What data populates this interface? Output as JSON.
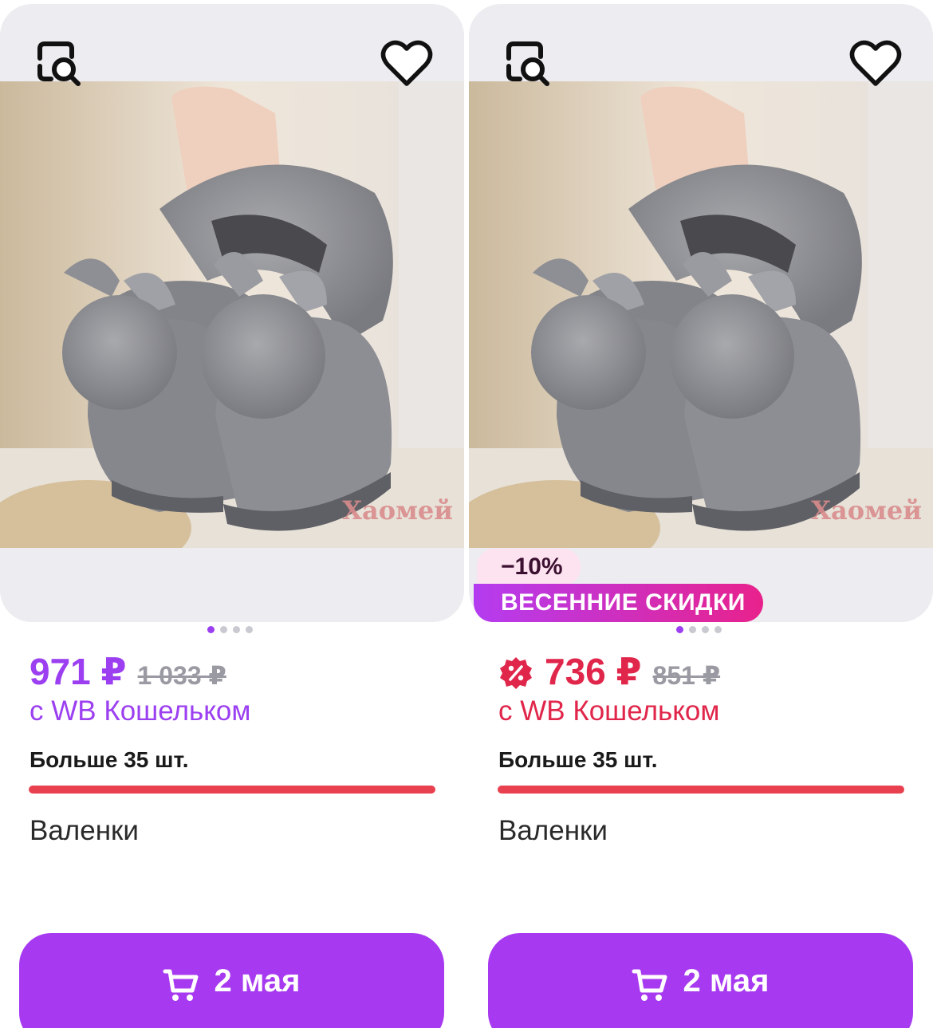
{
  "colors": {
    "accent_purple": "#9b3ff0",
    "price_red": "#e0264a",
    "stock_bar": "#e8404f",
    "button": "#a73af0"
  },
  "cards": [
    {
      "image_watermark": "Хаомей",
      "price": "971 ₽",
      "old_price": "1 033 ₽",
      "wallet_text": "с WB Кошельком",
      "stock_text": "Больше 35 шт.",
      "name": "Валенки",
      "delivery": "2 мая",
      "price_color": "#9b3ff0",
      "icons": [
        "search-image-icon",
        "heart-icon",
        "cart-icon"
      ]
    },
    {
      "image_watermark": "Хаомей",
      "discount_badge": "−10%",
      "promo_badge": "ВЕСЕННИЕ СКИДКИ",
      "price": "736 ₽",
      "old_price": "851 ₽",
      "wallet_text": "с WB Кошельком",
      "stock_text": "Больше 35 шт.",
      "name": "Валенки",
      "delivery": "2 мая",
      "price_color": "#e0264a",
      "icons": [
        "search-image-icon",
        "heart-icon",
        "percent-badge-icon",
        "cart-icon"
      ]
    }
  ]
}
